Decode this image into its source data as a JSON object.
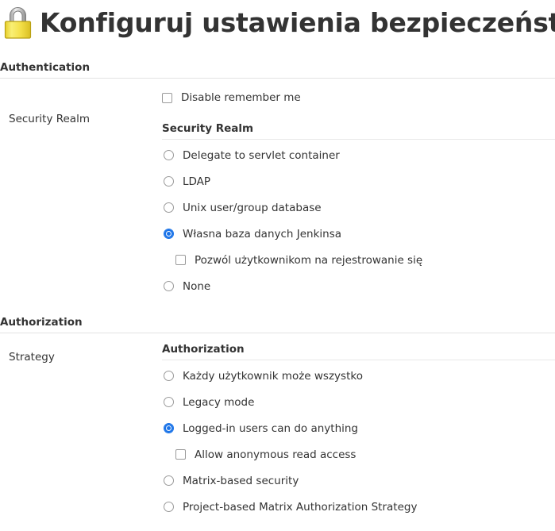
{
  "header": {
    "icon": "lock-icon",
    "title": "Konfiguruj ustawienia bezpieczeństwa"
  },
  "sections": [
    {
      "heading": "Authentication",
      "row_label": "Security Realm",
      "top_checkbox": {
        "label": "Disable remember me",
        "checked": false
      },
      "group": {
        "heading": "Security Realm",
        "options": [
          {
            "label": "Delegate to servlet container",
            "checked": false,
            "nested": false,
            "type": "radio"
          },
          {
            "label": "LDAP",
            "checked": false,
            "nested": false,
            "type": "radio"
          },
          {
            "label": "Unix user/group database",
            "checked": false,
            "nested": false,
            "type": "radio"
          },
          {
            "label": "Własna baza danych Jenkinsa",
            "checked": true,
            "nested": false,
            "type": "radio"
          },
          {
            "label": "Pozwól użytkownikom na rejestrowanie się",
            "checked": false,
            "nested": true,
            "type": "checkbox"
          },
          {
            "label": "None",
            "checked": false,
            "nested": false,
            "type": "radio"
          }
        ]
      }
    },
    {
      "heading": "Authorization",
      "row_label": "Strategy",
      "top_checkbox": null,
      "group": {
        "heading": "Authorization",
        "options": [
          {
            "label": "Każdy użytkownik może wszystko",
            "checked": false,
            "nested": false,
            "type": "radio"
          },
          {
            "label": "Legacy mode",
            "checked": false,
            "nested": false,
            "type": "radio"
          },
          {
            "label": "Logged-in users can do anything",
            "checked": true,
            "nested": false,
            "type": "radio"
          },
          {
            "label": "Allow anonymous read access",
            "checked": false,
            "nested": true,
            "type": "checkbox"
          },
          {
            "label": "Matrix-based security",
            "checked": false,
            "nested": false,
            "type": "radio"
          },
          {
            "label": "Project-based Matrix Authorization Strategy",
            "checked": false,
            "nested": false,
            "type": "radio"
          }
        ]
      }
    }
  ],
  "colors": {
    "accent": "#1a73e8",
    "text": "#333333",
    "rule": "#e3e3e3",
    "lock_body": "#f2e03c",
    "lock_shackle": "#b8b8b8"
  }
}
